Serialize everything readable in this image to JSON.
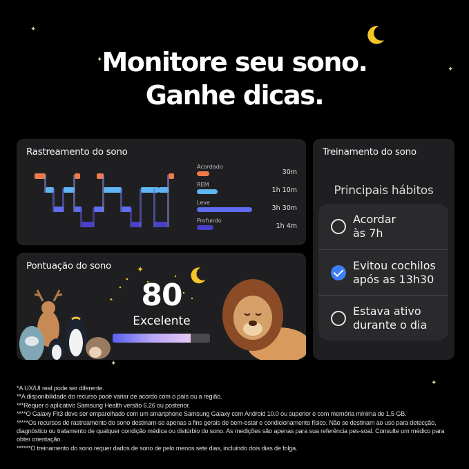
{
  "headline": {
    "line1": "Monitore seu sono.",
    "line2": "Ganhe dicas."
  },
  "sleep_tracking": {
    "title": "Rastreamento do sono",
    "stages": [
      {
        "label": "Acordado",
        "value": "30m",
        "color": "#f07a4a",
        "fraction": 0.13
      },
      {
        "label": "REM",
        "value": "1h 10m",
        "color": "#5fb6f2",
        "fraction": 0.3
      },
      {
        "label": "Leve",
        "value": "3h 30m",
        "color": "#5f6cf0",
        "fraction": 1.0
      },
      {
        "label": "Profundo",
        "value": "1h 4m",
        "color": "#4a3fc8",
        "fraction": 0.27
      }
    ]
  },
  "sleep_score": {
    "title": "Pontuação do sono",
    "value": "80",
    "label": "Excelente",
    "progress": 0.8
  },
  "sleep_training": {
    "title": "Treinamento do sono",
    "habits_title": "Principais hábitos",
    "habits": [
      {
        "text": "Acordar\nàs 7h",
        "checked": false
      },
      {
        "text": "Evitou cochilos\napós as 13h30",
        "checked": true
      },
      {
        "text": "Estava ativo\ndurante o dia",
        "checked": false
      }
    ]
  },
  "footnotes": [
    "*A UX/UI real pode ser diferente.",
    "**A disponibilidade do recurso pode variar de acordo com o país ou a região.",
    "***Requer o aplicativo Samsung Health versão 6.26 ou posterior.",
    "****O Galaxy Fit3 deve ser emparelhado com um smartphone Samsung Galaxy com Android 10.0 ou superior e com memória mínima de 1,5 GB.",
    "*****Os recursos de rastreamento do sono destinam-se apenas a fins gerais de bem-estar e condicionamento físico. Não se destinam ao uso para detecção, diagnóstico ou tratamento de qualquer condição médica ou distúrbio do sono. As medições são apenas para sua referência pes-soal. Consulte um médico para obter orientação.",
    "******O treinamento do sono requer dados de sono de pelo menos sete dias, incluindo dois dias de folga."
  ],
  "colors": {
    "background": "#000000",
    "card": "#1f1f22",
    "accent_blue": "#3d7ef5",
    "moon": "#f5c62a"
  },
  "icons": [
    "moon-icon",
    "star-icon",
    "check-icon",
    "circle-icon"
  ]
}
